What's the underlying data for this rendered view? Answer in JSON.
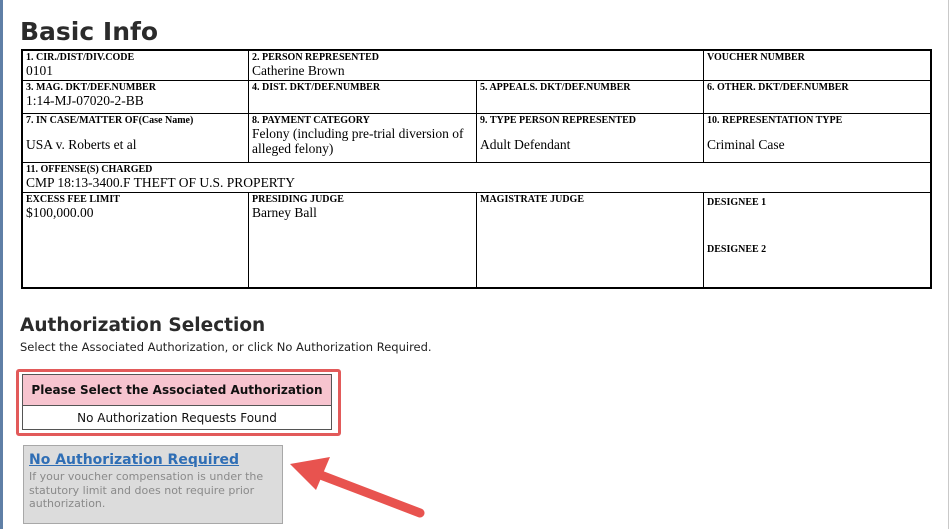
{
  "basic_info": {
    "title": "Basic Info",
    "cir_code_label": "1. CIR./DIST/DIV.CODE",
    "cir_code_value": "0101",
    "person_label": "2. PERSON REPRESENTED",
    "person_value": "Catherine Brown",
    "voucher_label": "VOUCHER NUMBER",
    "voucher_value": "",
    "mag_label": "3. MAG. DKT/DEF.NUMBER",
    "mag_value": "1:14-MJ-07020-2-BB",
    "dist_label": "4. DIST. DKT/DEF.NUMBER",
    "dist_value": "",
    "appeals_label": "5. APPEALS. DKT/DEF.NUMBER",
    "appeals_value": "",
    "other_label": "6. OTHER. DKT/DEF.NUMBER",
    "other_value": "",
    "case_label": "7. IN CASE/MATTER OF(Case Name)",
    "case_value": "USA v. Roberts et al",
    "payment_label": "8. PAYMENT CATEGORY",
    "payment_value": "Felony (including pre-trial diversion of alleged felony)",
    "type_label": "9. TYPE PERSON REPRESENTED",
    "type_value": "Adult Defendant",
    "rep_label": "10. REPRESENTATION TYPE",
    "rep_value": "Criminal Case",
    "offense_label": "11. OFFENSE(S) CHARGED",
    "offense_value": "CMP 18:13-3400.F THEFT OF U.S. PROPERTY",
    "excess_label": "EXCESS FEE LIMIT",
    "excess_value": "$100,000.00",
    "presiding_label": "PRESIDING JUDGE",
    "presiding_value": "Barney Ball",
    "magistrate_label": "MAGISTRATE JUDGE",
    "magistrate_value": "",
    "designee1_label": "DESIGNEE 1",
    "designee2_label": "DESIGNEE 2"
  },
  "authorization": {
    "title": "Authorization Selection",
    "help": "Select the Associated Authorization, or click No Authorization Required.",
    "table_header": "Please Select the Associated Authorization",
    "table_empty": "No Authorization Requests Found",
    "no_auth_link": "No Authorization Required",
    "no_auth_desc": "If your voucher compensation is under the statutory limit and does not require prior authorization."
  },
  "colors": {
    "highlight_outline": "#e25a5a",
    "table_header_bg": "#f7c4cf",
    "link": "#2f6eb5",
    "arrow": "#e8534f"
  },
  "icons": {
    "callout": "red-arrow-icon"
  }
}
